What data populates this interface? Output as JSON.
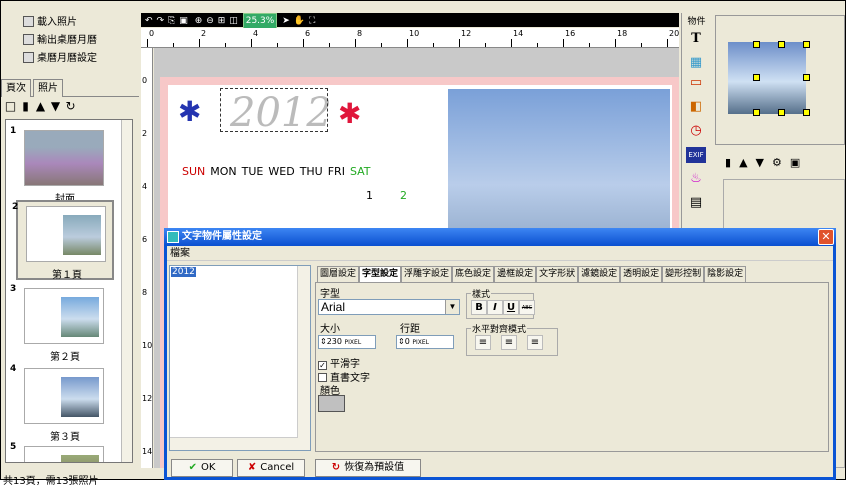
{
  "sidebar": {
    "menu": [
      {
        "label": "載入照片",
        "icon": "folder-open-icon"
      },
      {
        "label": "輸出桌曆月曆",
        "icon": "save-icon"
      },
      {
        "label": "桌曆月曆設定",
        "icon": "document-icon"
      }
    ],
    "tabs": [
      "頁次",
      "照片"
    ],
    "tools": [
      "new-page-icon",
      "delete-icon",
      "move-up-icon",
      "move-down-icon",
      "refresh-icon"
    ],
    "pages": [
      {
        "num": "1",
        "label": "封面"
      },
      {
        "num": "2",
        "label": "第１頁",
        "selected": true
      },
      {
        "num": "3",
        "label": "第２頁"
      },
      {
        "num": "4",
        "label": "第３頁"
      },
      {
        "num": "5",
        "label": ""
      }
    ],
    "status": "共13頁，需13張照片"
  },
  "toolbar": {
    "zoom": "25.3%",
    "ruler_labels": [
      "0",
      "2",
      "4",
      "6",
      "8",
      "10",
      "12",
      "14",
      "16",
      "18",
      "20"
    ],
    "vruler_labels": [
      "0",
      "2",
      "4",
      "6",
      "8",
      "10",
      "12",
      "14"
    ]
  },
  "canvas": {
    "year_text": "2012",
    "weekdays": [
      "SUN",
      "MON",
      "TUE",
      "WED",
      "THU",
      "FRI",
      "SAT"
    ],
    "day1": "1",
    "day2": "2"
  },
  "objects": {
    "title": "物件",
    "items": [
      "text-icon",
      "image-icon",
      "frame-icon",
      "layer-icon",
      "clock-icon",
      "exif-icon",
      "cake-icon",
      "calendar-icon"
    ]
  },
  "right_tools": [
    "delete-icon",
    "move-up-icon",
    "move-down-icon",
    "properties-icon",
    "view-icon"
  ],
  "dialog": {
    "title": "文字物件屬性設定",
    "menu": "檔案",
    "list_item": "2012",
    "tabs": [
      "圖層設定",
      "字型設定",
      "浮雕字設定",
      "底色設定",
      "邊框設定",
      "文字形狀",
      "濾鏡設定",
      "透明設定",
      "變形控制",
      "陰影設定"
    ],
    "active_tab": "字型設定",
    "font_label": "字型",
    "font_value": "Arial",
    "size_label": "大小",
    "size_value": "230",
    "size_unit": "PIXEL",
    "spacing_label": "行距",
    "spacing_value": "0",
    "spacing_unit": "PIXEL",
    "smooth_label": "平滑字",
    "vertical_label": "直書文字",
    "color_label": "顏色",
    "style_group": "樣式",
    "style_buttons": [
      "B",
      "I",
      "U",
      "ABC"
    ],
    "align_group": "水平對齊模式",
    "ok_label": "OK",
    "cancel_label": "Cancel",
    "reset_label": "恢復為預設值"
  }
}
